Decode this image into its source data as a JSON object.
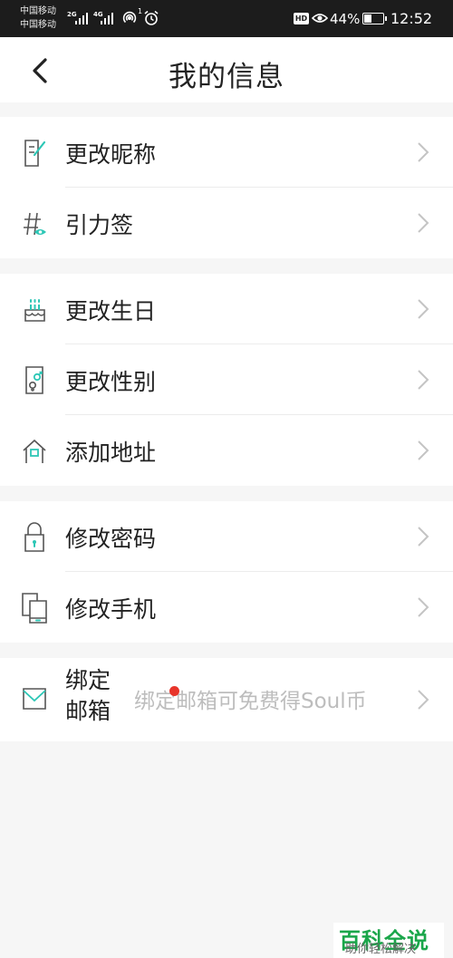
{
  "status_bar": {
    "carrier_1": "中国移动",
    "carrier_2": "中国移动",
    "network_1": "2G",
    "network_2": "4G",
    "hotspot_count": "1",
    "hd": "HD",
    "battery_percent": "44%",
    "battery_level": 0.44,
    "time": "12:52"
  },
  "header": {
    "title": "我的信息"
  },
  "groups": [
    {
      "items": [
        {
          "label": "更改昵称",
          "icon": "edit-note-icon"
        },
        {
          "label": "引力签",
          "icon": "hashtag-eye-icon"
        }
      ]
    },
    {
      "items": [
        {
          "label": "更改生日",
          "icon": "cake-icon"
        },
        {
          "label": "更改性别",
          "icon": "gender-icon"
        },
        {
          "label": "添加地址",
          "icon": "home-icon"
        }
      ]
    },
    {
      "items": [
        {
          "label": "修改密码",
          "icon": "lock-icon"
        },
        {
          "label": "修改手机",
          "icon": "phone-icon"
        }
      ]
    },
    {
      "items": [
        {
          "label": "绑定邮箱",
          "icon": "mail-icon",
          "hint": "绑定邮箱可免费得Soul币"
        }
      ]
    }
  ],
  "watermark": {
    "title": "百科全说",
    "subtitle": "助你轻松解决"
  },
  "colors": {
    "accent": "#2dc7b6",
    "red_dot": "#e8352b",
    "watermark_green": "#1aa64a"
  }
}
